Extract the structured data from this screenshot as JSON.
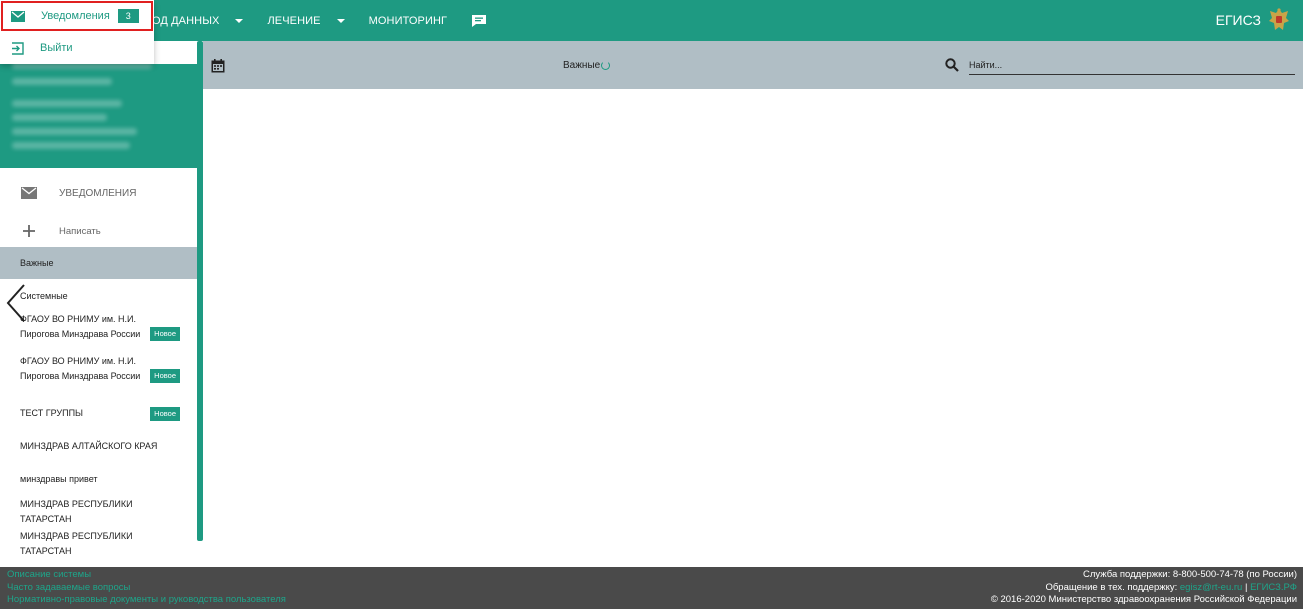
{
  "topnav": {
    "items": [
      {
        "label": "ОД ДАННЫХ",
        "has_caret": true
      },
      {
        "label": "ЛЕЧЕНИЕ",
        "has_caret": true
      },
      {
        "label": "МОНИТОРИНГ",
        "has_caret": false
      }
    ],
    "brand": "ЕГИСЗ"
  },
  "user_menu": {
    "notifications_label": "Уведомления",
    "notifications_count": "3",
    "logout_label": "Выйти"
  },
  "sidebar": {
    "header": "УВЕДОМЛЕНИЯ",
    "compose": "Написать",
    "folders": [
      "Важные",
      "Системные"
    ],
    "groups": [
      {
        "name": "ФГАОУ ВО РНИМУ им. Н.И. Пирогова Минздрава России",
        "badge": "Новое"
      },
      {
        "name": "ФГАОУ ВО РНИМУ им. Н.И. Пирогова Минздрава России",
        "badge": "Новое"
      },
      {
        "name": "ТЕСТ ГРУППЫ",
        "badge": "Новое"
      },
      {
        "name": "МИНЗДРАВ АЛТАЙСКОГО КРАЯ",
        "badge": ""
      },
      {
        "name": "минздравы привет",
        "badge": ""
      },
      {
        "name": "МИНЗДРАВ РЕСПУБЛИКИ ТАТАРСТАН",
        "badge": ""
      },
      {
        "name": "МИНЗДРАВ РЕСПУБЛИКИ ТАТАРСТАН",
        "badge": ""
      }
    ]
  },
  "toolbar": {
    "title": "Важные",
    "search_placeholder": "Найти..."
  },
  "footer": {
    "links": [
      "Описание системы",
      "Часто задаваемые вопросы",
      "Нормативно-правовые документы и руководства пользователя"
    ],
    "support_phone": "Служба поддержки: 8-800-500-74-78 (по России)",
    "support_prefix": "Обращение в тех. поддержку:",
    "support_email": "egisz@rt-eu.ru",
    "separator": "|",
    "support_site": "ЕГИСЗ.РФ",
    "copyright": "© 2016-2020 Министерство здравоохранения Российской Федерации"
  },
  "colors": {
    "accent": "#1e9a82",
    "toolbar": "#b0bec5",
    "footer": "#4a4a4a",
    "highlight": "#e02020"
  }
}
